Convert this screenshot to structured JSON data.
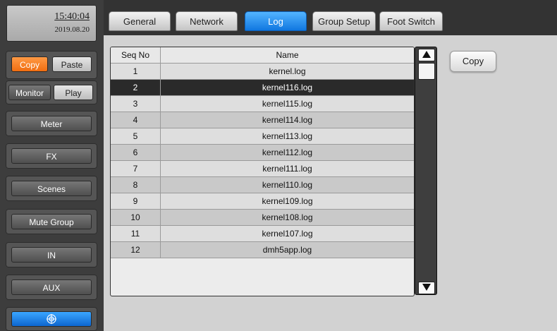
{
  "clock": {
    "time": "15:40:04",
    "date": "2019.08.20"
  },
  "sidebar": {
    "copy_label": "Copy",
    "paste_label": "Paste",
    "monitor_label": "Monitor",
    "play_label": "Play",
    "meter_label": "Meter",
    "fx_label": "FX",
    "scenes_label": "Scenes",
    "mute_group_label": "Mute Group",
    "in_label": "IN",
    "aux_label": "AUX",
    "home_icon": "target-icon"
  },
  "tabs": [
    {
      "label": "General"
    },
    {
      "label": "Network"
    },
    {
      "label": "Log",
      "active": true
    },
    {
      "label": "Group Setup"
    },
    {
      "label": "Foot Switch"
    }
  ],
  "table": {
    "headers": {
      "seq": "Seq No",
      "name": "Name"
    },
    "selected_index": 1,
    "rows": [
      {
        "seq": "1",
        "name": "kernel.log"
      },
      {
        "seq": "2",
        "name": "kernel116.log"
      },
      {
        "seq": "3",
        "name": "kernel115.log"
      },
      {
        "seq": "4",
        "name": "kernel114.log"
      },
      {
        "seq": "5",
        "name": "kernel113.log"
      },
      {
        "seq": "6",
        "name": "kernel112.log"
      },
      {
        "seq": "7",
        "name": "kernel111.log"
      },
      {
        "seq": "8",
        "name": "kernel110.log"
      },
      {
        "seq": "9",
        "name": "kernel109.log"
      },
      {
        "seq": "10",
        "name": "kernel108.log"
      },
      {
        "seq": "11",
        "name": "kernel107.log"
      },
      {
        "seq": "12",
        "name": "dmh5app.log"
      }
    ]
  },
  "actions": {
    "copy_label": "Copy"
  },
  "colors": {
    "accent_blue": "#1a85f0",
    "accent_orange": "#f5801f",
    "selected_row": "#2a2a2a"
  }
}
